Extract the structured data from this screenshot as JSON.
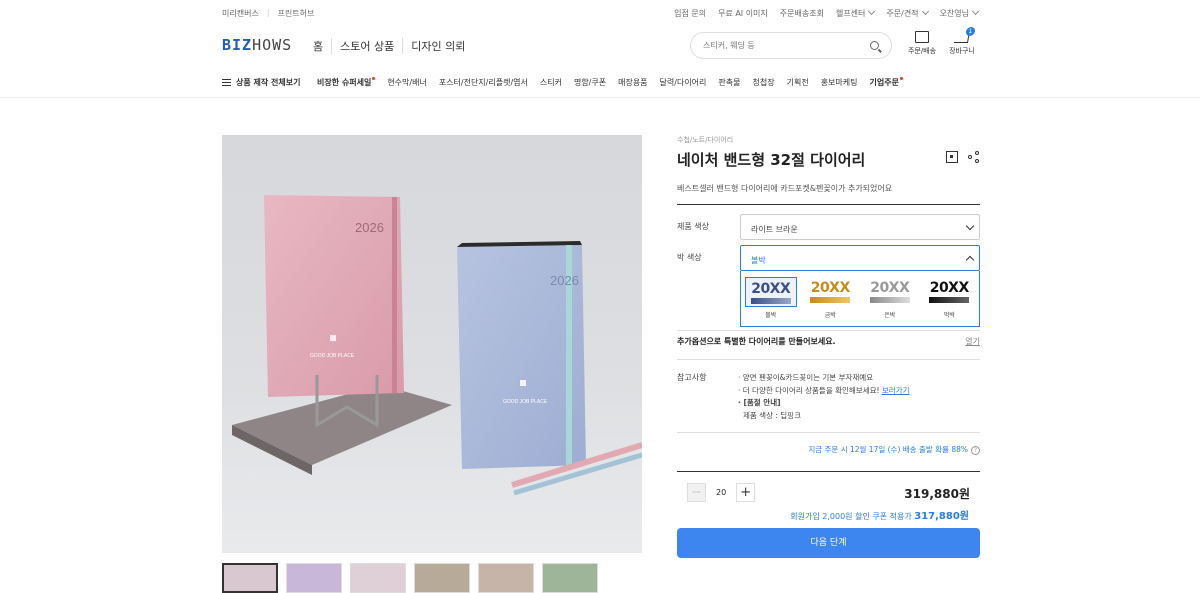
{
  "top_util": {
    "left": [
      "미리캔버스",
      "프린트허브"
    ],
    "right": [
      "입점 문의",
      "무료 AI 이미지",
      "주문배송조회",
      "헬프센터",
      "주문/견적",
      "오찬영님"
    ]
  },
  "header": {
    "logo_a": "BIZ",
    "logo_b": "HOWS",
    "nav": [
      "홈",
      "스토어 상품",
      "디자인 의뢰"
    ],
    "search_placeholder": "스티커, 웨딩 등",
    "icons": {
      "order": "주문/배송",
      "cart": "장바구니",
      "cart_count": "1"
    }
  },
  "catnav": {
    "all": "상품 제작 전체보기",
    "items": [
      "비장한 슈퍼세일",
      "현수막/배너",
      "포스터/전단지/리플렛/엽서",
      "스티커",
      "명함/쿠폰",
      "매장용품",
      "달력/다이어리",
      "판촉물",
      "청첩장",
      "기획전",
      "홍보마케팅",
      "기업주문"
    ]
  },
  "product": {
    "breadcrumb": "수첩/노트/다이어리",
    "title": "네이처 밴드형 32절 다이어리",
    "subtitle": "베스트셀러 밴드형 다이어리에 카드포켓&펜꽂이가 추가되었어요",
    "book1_year": "2026",
    "book2_year": "2026",
    "book_brand": "GOOD JOB PLACE"
  },
  "options": {
    "color_label": "제품 색상",
    "color_value": "라이트 브라운",
    "foil_label": "박 색상",
    "foil_value": "볼박",
    "swatches": [
      {
        "text": "20XX",
        "name": "볼박",
        "color": "#3a4f8a"
      },
      {
        "text": "20XX",
        "name": "금박",
        "color": "#c78a1d"
      },
      {
        "text": "20XX",
        "name": "은박",
        "color": "#9a9a9a"
      },
      {
        "text": "20XX",
        "name": "먹박",
        "color": "#111111"
      }
    ]
  },
  "addopt": {
    "label": "추가옵션으로 특별한 다이어리를 만들어보세요.",
    "open": "열기"
  },
  "notes": {
    "label": "참고사항",
    "l1": "· 양면 펜꽂이&카드꽂이는 기본 부자재예요",
    "l2": "· 더 다양한 다이어리 상품들을 확인해보세요!",
    "l2_link": "보러가기",
    "l3": "· [품절 안내]",
    "l4": "제품 색상 : 딥핑크"
  },
  "shipping": "지금 주문 시 12월 17일 (수) 배송 출발 확률 88%",
  "qty": {
    "value": "20",
    "minus": "−",
    "plus": "+"
  },
  "price": "319,880원",
  "coupon": {
    "text": "회원가입 2,000원 할인 쿠폰 적용가",
    "price": "317,880원"
  },
  "next_button": "다음 단계"
}
